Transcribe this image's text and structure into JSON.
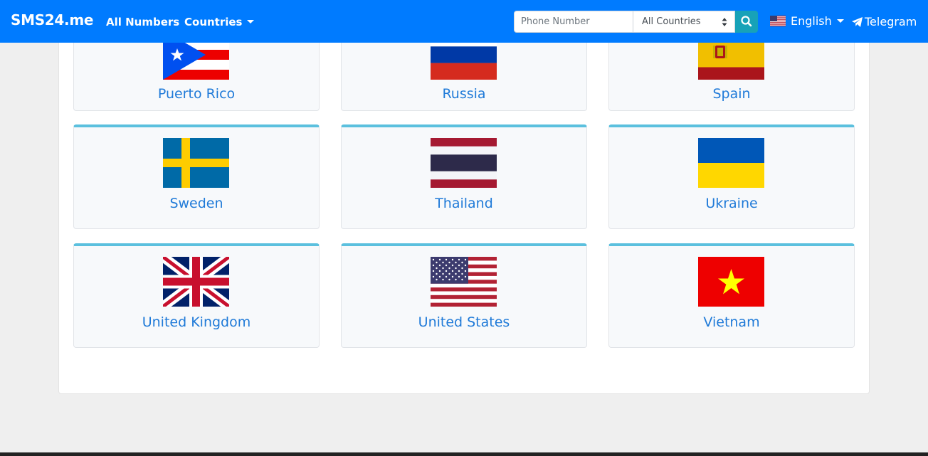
{
  "navbar": {
    "brand": "SMS24.me",
    "all_numbers": "All Numbers",
    "countries": "Countries",
    "search_placeholder": "Phone Number",
    "country_select_value": "All Countries",
    "language": "English",
    "telegram": "Telegram",
    "accent_color": "#007bff",
    "search_button_color": "#17a2b8"
  },
  "countries": [
    {
      "name": "Puerto Rico",
      "flag": "puerto-rico-flag"
    },
    {
      "name": "Russia",
      "flag": "russia-flag"
    },
    {
      "name": "Spain",
      "flag": "spain-flag"
    },
    {
      "name": "Sweden",
      "flag": "sweden-flag"
    },
    {
      "name": "Thailand",
      "flag": "thailand-flag"
    },
    {
      "name": "Ukraine",
      "flag": "ukraine-flag"
    },
    {
      "name": "United Kingdom",
      "flag": "united-kingdom-flag"
    },
    {
      "name": "United States",
      "flag": "united-states-flag"
    },
    {
      "name": "Vietnam",
      "flag": "vietnam-flag"
    }
  ]
}
